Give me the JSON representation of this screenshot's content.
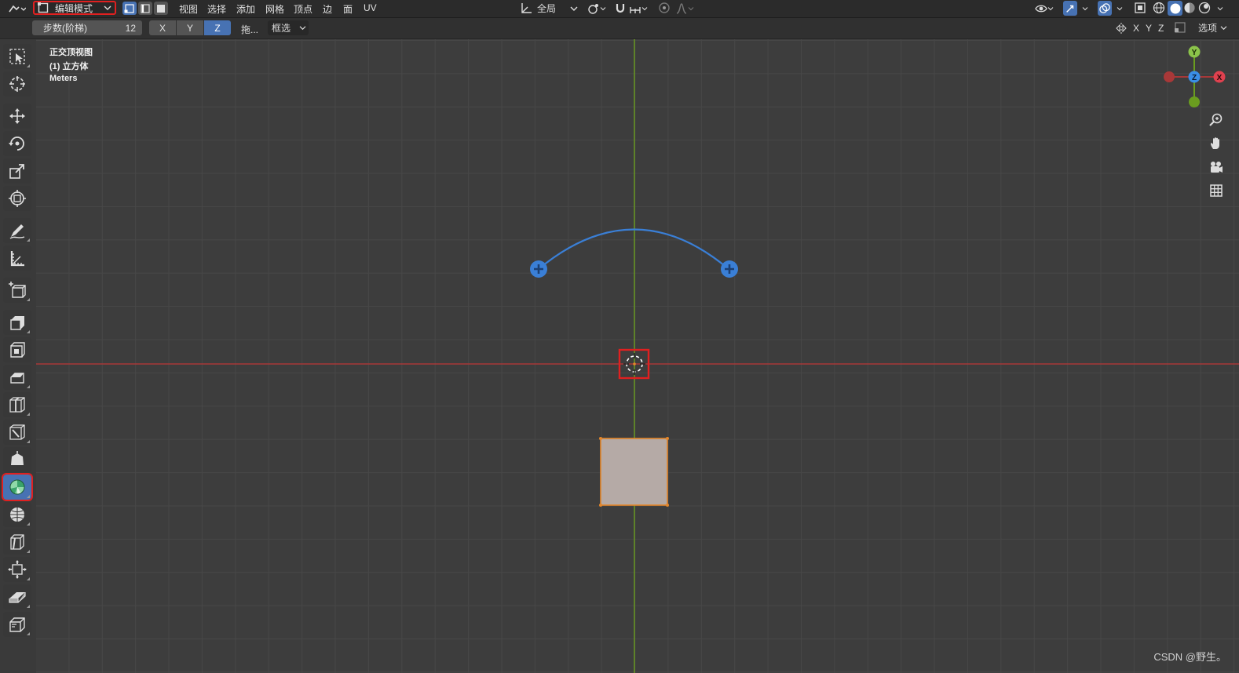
{
  "header": {
    "mode_label": "编辑模式",
    "menus": [
      "视图",
      "选择",
      "添加",
      "网格",
      "顶点",
      "边",
      "面",
      "UV"
    ],
    "orientation_label": "全局",
    "options_label": "选项",
    "axis_labels": [
      "X",
      "Y",
      "Z"
    ]
  },
  "tool_settings": {
    "steps_label": "步数(阶梯)",
    "steps_value": "12",
    "axes": [
      "X",
      "Y",
      "Z"
    ],
    "active_axis": "Z",
    "drag_label": "拖...",
    "select_mode": "框选"
  },
  "viewport": {
    "view_name": "正交顶视图",
    "object_name": "(1) 立方体",
    "units": "Meters",
    "gizmo": {
      "y": "Y",
      "z": "Z",
      "x": "X"
    }
  },
  "toolbar": {
    "tools": [
      "select-box",
      "cursor",
      "move",
      "rotate",
      "scale",
      "transform",
      "annotate",
      "measure",
      "add-cube",
      "extrude-region",
      "inset-faces",
      "bevel",
      "loop-cut",
      "knife",
      "poly-build",
      "spin",
      "smooth",
      "edge-slide",
      "shrink-fatten",
      "shear",
      "rip-region"
    ],
    "active_tool": "spin"
  },
  "colors": {
    "accent": "#4772b3",
    "highlight": "#e02020",
    "x_axis": "#a83838",
    "y_axis": "#6a9d1f",
    "arc": "#3a7fd6",
    "face": "#b5aaa6",
    "selection": "#e3862a"
  },
  "watermark": "CSDN @野生。"
}
